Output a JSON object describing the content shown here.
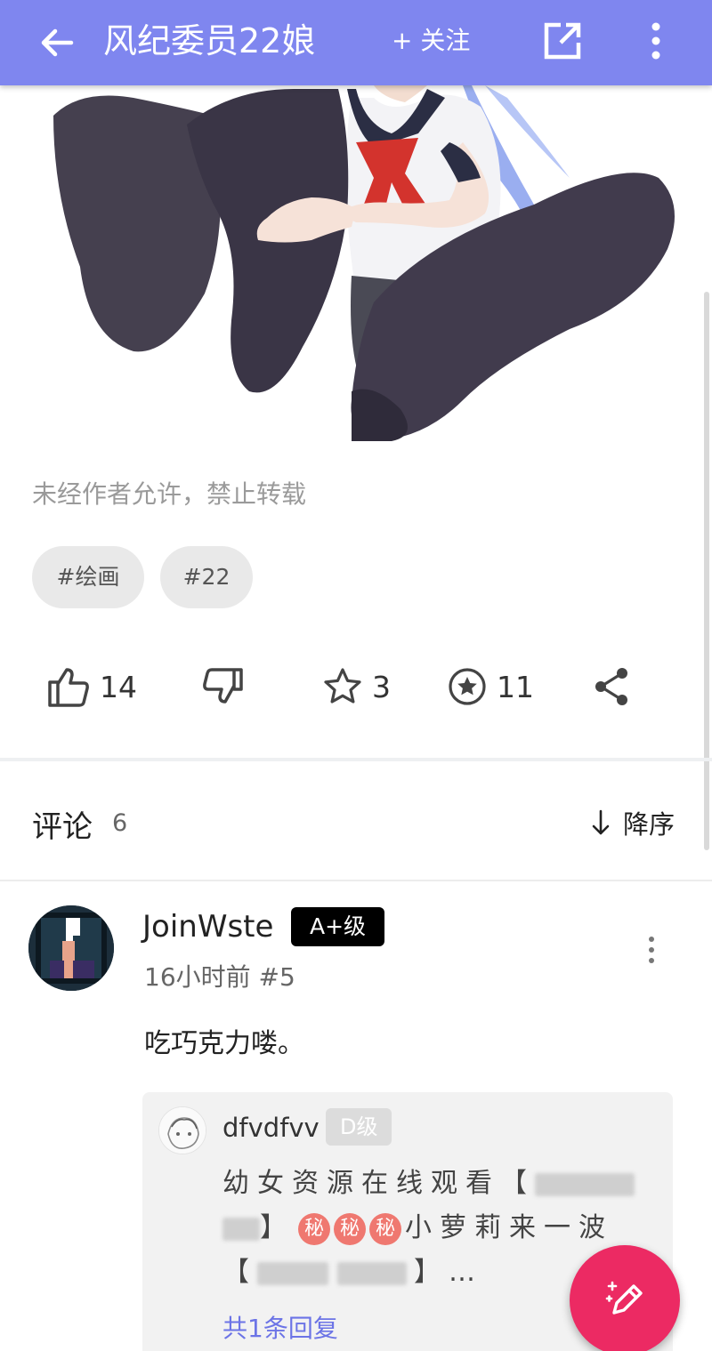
{
  "header": {
    "title": "风纪委员22娘",
    "follow_label": "+ 关注",
    "back_icon": "arrow-left-icon",
    "open_icon": "open-in-new-icon",
    "more_icon": "more-vertical-icon",
    "bar_color": "#7f86ef"
  },
  "post": {
    "copyright_notice": "未经作者允许，禁止转载",
    "tags": [
      "#绘画",
      "#22"
    ]
  },
  "actions": {
    "like_count": "14",
    "favorite_count": "3",
    "coin_count": "11",
    "icons": [
      "thumb-up-icon",
      "thumb-down-icon",
      "star-icon",
      "star-circle-icon",
      "share-icon"
    ]
  },
  "comments": {
    "title": "评论",
    "count": "6",
    "sort_label": "降序",
    "items": [
      {
        "username": "JoinWste",
        "level": "A+级",
        "meta": "16小时前 #5",
        "text": "吃巧克力喽。",
        "reply": {
          "username": "dfvdfvv",
          "level": "D级",
          "line1": "幼女资源在线观看【",
          "line2_end": "】",
          "secret_glyph": "秘",
          "line2_tail": "小萝莉来一波",
          "line3_open": "【",
          "line3_close": "】…",
          "more_label": "共1条回复"
        }
      }
    ]
  },
  "fab": {
    "icon": "edit-pen-icon",
    "color": "#ec2a63"
  }
}
